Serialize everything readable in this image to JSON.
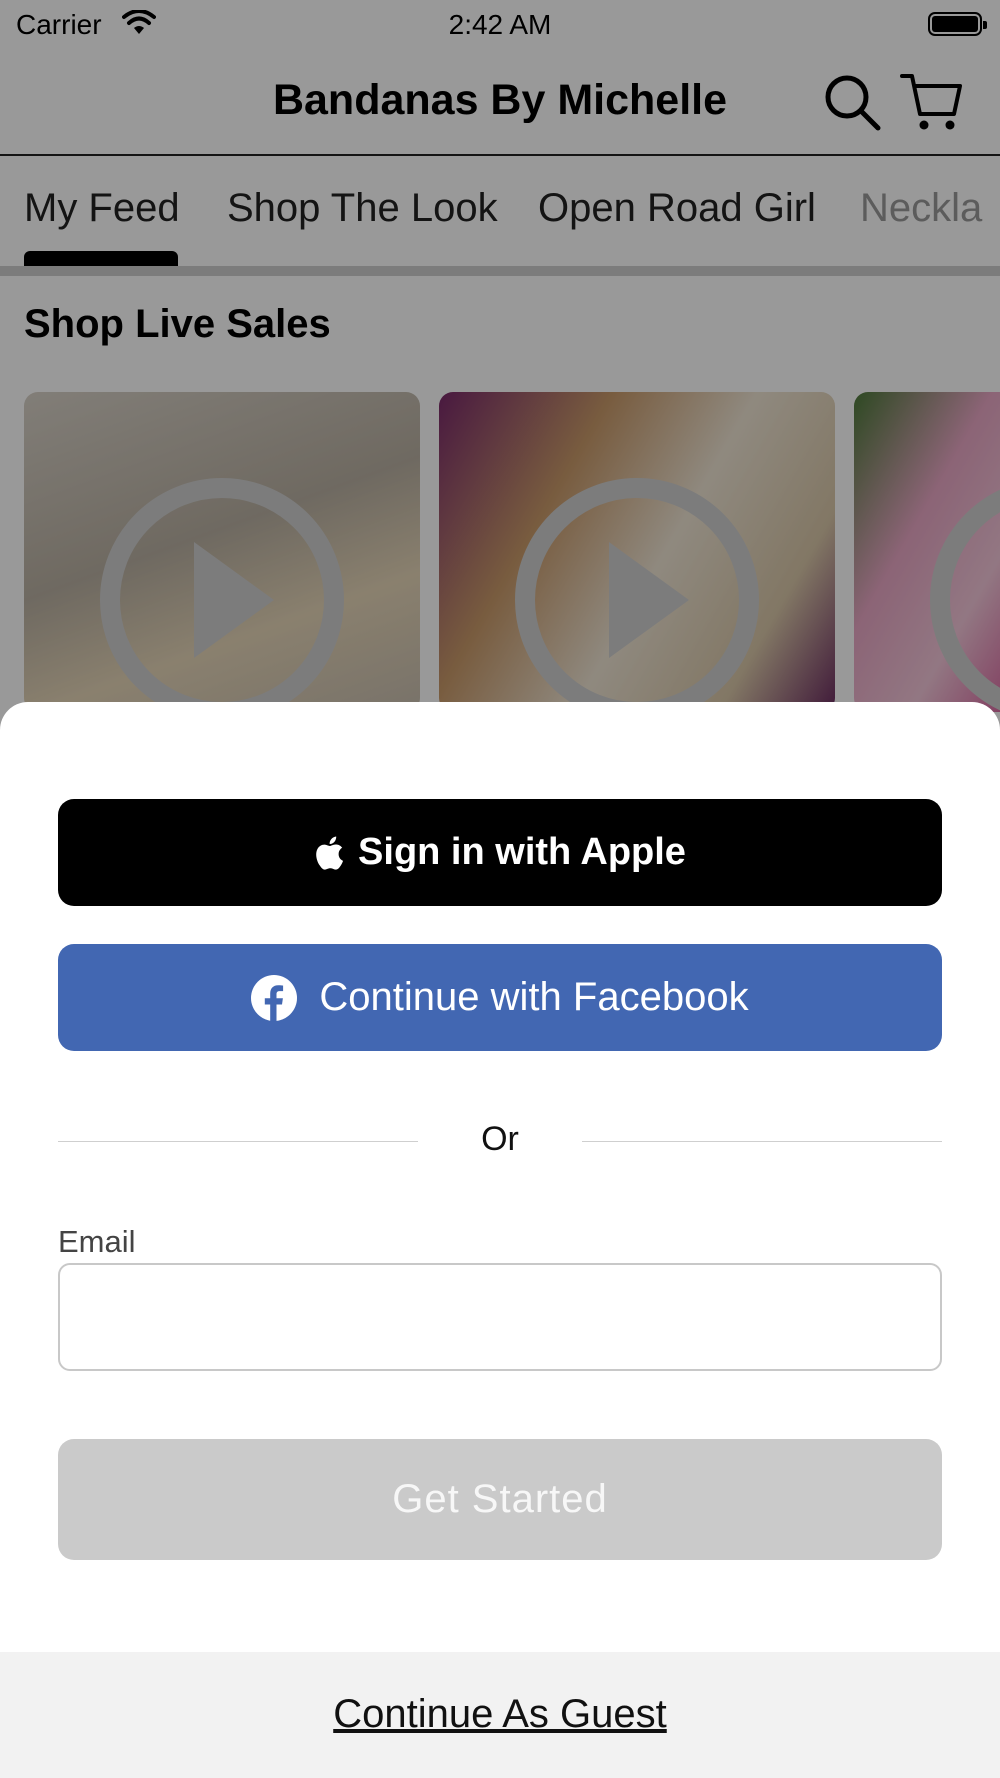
{
  "status_bar": {
    "carrier": "Carrier",
    "time": "2:42 AM"
  },
  "header": {
    "title": "Bandanas By Michelle"
  },
  "tabs": [
    {
      "label": "My Feed",
      "active": true
    },
    {
      "label": "Shop The Look"
    },
    {
      "label": "Open Road Girl"
    },
    {
      "label": "Neckla"
    }
  ],
  "live_sales": {
    "title": "Shop Live Sales"
  },
  "login_sheet": {
    "apple_label": "Sign in with Apple",
    "facebook_label": "Continue with Facebook",
    "or_text": "Or",
    "email_label": "Email",
    "email_value": "",
    "get_started_label": "Get Started",
    "guest_label": "Continue As Guest"
  },
  "colors": {
    "facebook_blue": "#4267b2",
    "apple_black": "#000000",
    "disabled_gray": "#cacaca",
    "overlay": "rgba(0,0,0,0.4)"
  },
  "icons": [
    "wifi-icon",
    "battery-icon",
    "search-icon",
    "cart-icon",
    "play-icon",
    "apple-icon",
    "facebook-icon"
  ]
}
